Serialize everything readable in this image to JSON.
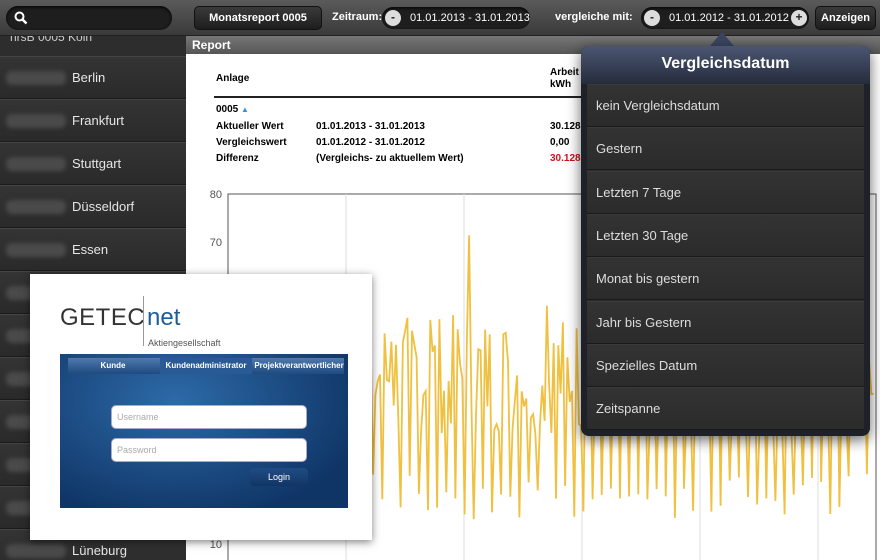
{
  "toolbar": {
    "report_label": "Monatsreport 0005",
    "zeitraum_label": "Zeitraum:",
    "zeitraum_value": "01.01.2013 - 31.01.2013",
    "vergleiche_label": "vergleiche mit:",
    "vergleiche_value": "01.01.2012 - 31.01.2012",
    "minus": "-",
    "plus": "+",
    "anzeigen_label": "Anzeigen"
  },
  "sidebar": {
    "first_partial": "nrsB 0005 Köln",
    "items": [
      {
        "label": "Berlin"
      },
      {
        "label": "Frankfurt"
      },
      {
        "label": "Stuttgart"
      },
      {
        "label": "Düsseldorf"
      },
      {
        "label": "Essen"
      },
      {
        "label": ""
      },
      {
        "label": ""
      },
      {
        "label": ""
      },
      {
        "label": ""
      },
      {
        "label": ""
      },
      {
        "label": ""
      },
      {
        "label": "Lüneburg"
      }
    ]
  },
  "report": {
    "header": "Report",
    "col_anlage": "Anlage",
    "col_arbeit": "Arbeit",
    "col_unit": "kWh",
    "id": "0005",
    "rows": [
      {
        "label": "Aktueller Wert",
        "period": "01.01.2013 - 31.01.2013",
        "value": "30.128"
      },
      {
        "label": "Vergleichswert",
        "period": "01.01.2012 - 31.01.2012",
        "value": "0,00"
      },
      {
        "label": "Differenz",
        "period": "(Vergleichs- zu aktuellem Wert)",
        "value": "30.128"
      }
    ]
  },
  "chart_data": {
    "type": "line",
    "yticks": [
      "80",
      "70",
      "10"
    ],
    "color": "#f0c040"
  },
  "popover": {
    "title": "Vergleichsdatum",
    "items": [
      "kein Vergleichsdatum",
      "Gestern",
      "Letzten 7 Tage",
      "Letzten 30 Tage",
      "Monat bis gestern",
      "Jahr bis Gestern",
      "Spezielles Datum",
      "Zeitspanne"
    ]
  },
  "login": {
    "logo_getec": "GETEC",
    "logo_net": "net",
    "logo_sub": "Aktiengesellschaft",
    "tabs": [
      "Kunde",
      "Kundenadministrator",
      "Projektverantwortlicher"
    ],
    "username_placeholder": "Username",
    "password_placeholder": "Password",
    "login_button": "Login"
  }
}
